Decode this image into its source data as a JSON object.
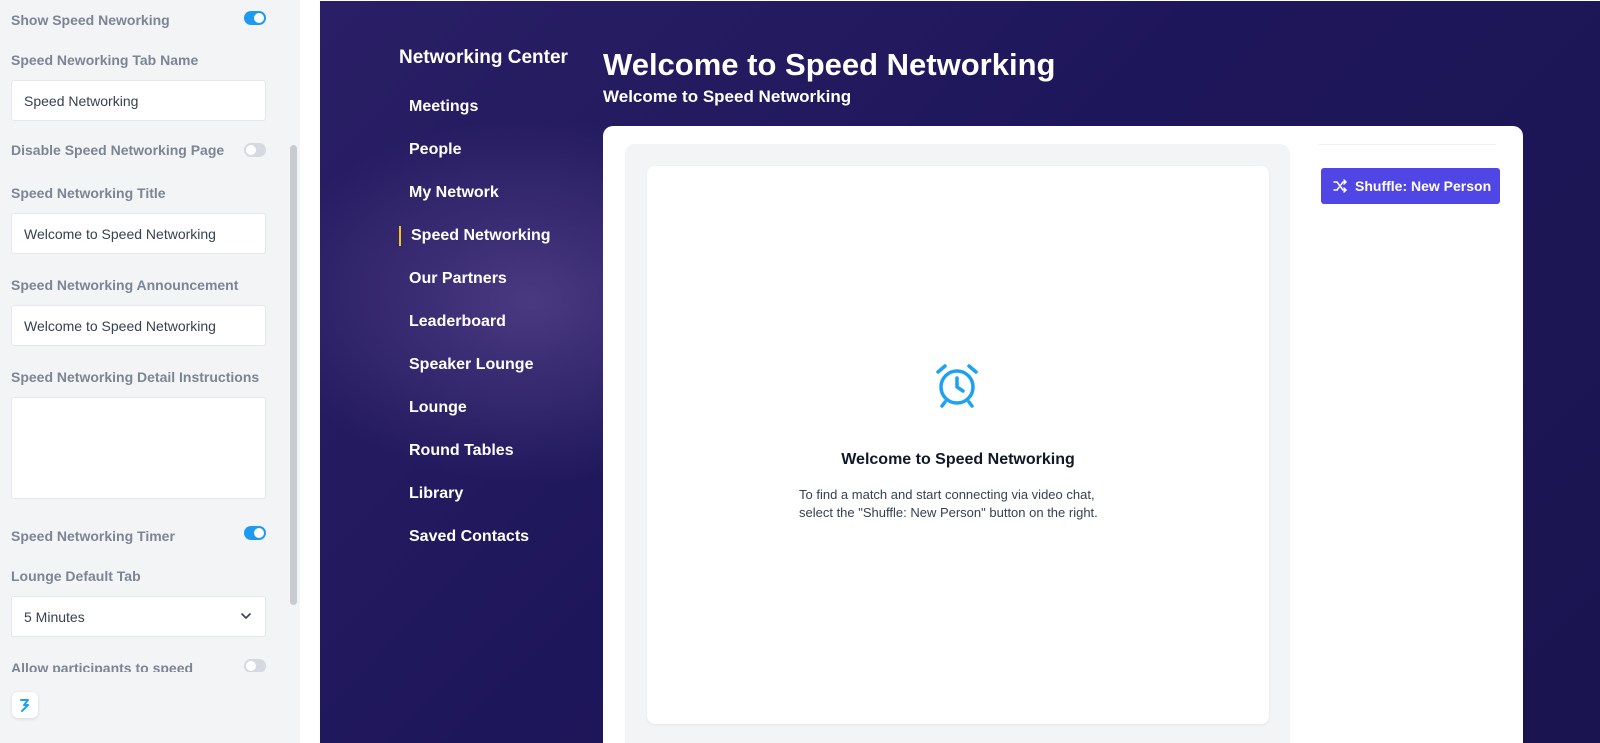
{
  "settings": {
    "show_speed_networking": {
      "label": "Show Speed Neworking",
      "on": true
    },
    "tab_name": {
      "label": "Speed Neworking Tab Name",
      "value": "Speed Networking"
    },
    "disable_page": {
      "label": "Disable Speed Networking Page",
      "on": false
    },
    "title": {
      "label": "Speed Networking Title",
      "value": "Welcome to Speed Networking"
    },
    "announcement": {
      "label": "Speed Networking Announcement",
      "value": "Welcome to Speed Networking"
    },
    "detail_instructions": {
      "label": "Speed Networking Detail Instructions",
      "value": ""
    },
    "timer": {
      "label": "Speed Networking Timer",
      "on": true
    },
    "lounge_default_tab": {
      "label": "Lounge Default Tab",
      "value": "5 Minutes"
    },
    "allow_participants": {
      "label": "Allow participants to speed",
      "on": false
    }
  },
  "nav": {
    "title": "Networking Center",
    "items": [
      {
        "label": "Meetings",
        "active": false
      },
      {
        "label": "People",
        "active": false
      },
      {
        "label": "My Network",
        "active": false
      },
      {
        "label": "Speed Networking",
        "active": true
      },
      {
        "label": "Our Partners",
        "active": false
      },
      {
        "label": "Leaderboard",
        "active": false
      },
      {
        "label": "Speaker Lounge",
        "active": false
      },
      {
        "label": "Lounge",
        "active": false
      },
      {
        "label": "Round Tables",
        "active": false
      },
      {
        "label": "Library",
        "active": false
      },
      {
        "label": "Saved Contacts",
        "active": false
      }
    ]
  },
  "page": {
    "title": "Welcome to Speed Networking",
    "announcement": "Welcome to Speed Networking"
  },
  "video": {
    "heading": "Welcome to Speed Networking",
    "instructions_line1": "To find a match and start connecting via video chat,",
    "instructions_line2": "select the \"Shuffle: New Person\" button on the right."
  },
  "actions": {
    "shuffle_label": "Shuffle: New Person"
  },
  "icons": {
    "clock": "alarm-clock-icon",
    "shuffle": "shuffle-icon",
    "chevron": "chevron-down-icon",
    "logo": "brand-logo-icon"
  },
  "colors": {
    "accent": "#4f46e5",
    "toggle_on": "#1e9bf0",
    "active_indicator": "#f5c518",
    "clock_icon": "#1da1f2",
    "nav_bg": "#241c60"
  }
}
